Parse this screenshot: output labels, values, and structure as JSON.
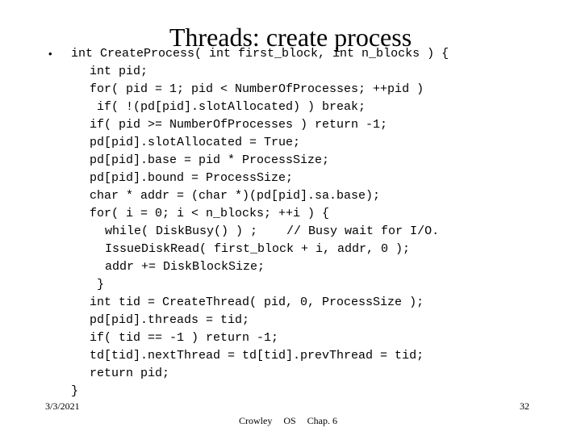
{
  "slide": {
    "title": "Threads: create process",
    "bullet_glyph": "•",
    "background_color": "#ffffff",
    "text_color": "#000000"
  },
  "code": {
    "lines": [
      {
        "indent": 0,
        "bulleted": true,
        "text": "int CreateProcess( int first_block, int n_blocks ) {"
      },
      {
        "indent": 1,
        "bulleted": false,
        "text": "int pid;"
      },
      {
        "indent": 1,
        "bulleted": false,
        "text": "for( pid = 1; pid < NumberOfProcesses; ++pid )"
      },
      {
        "indent": 2,
        "bulleted": false,
        "text": "if( !(pd[pid].slotAllocated) ) break;"
      },
      {
        "indent": 1,
        "bulleted": false,
        "text": "if( pid >= NumberOfProcesses ) return -1;"
      },
      {
        "indent": 1,
        "bulleted": false,
        "text": "pd[pid].slotAllocated = True;"
      },
      {
        "indent": 1,
        "bulleted": false,
        "text": "pd[pid].base = pid * ProcessSize;"
      },
      {
        "indent": 1,
        "bulleted": false,
        "text": "pd[pid].bound = ProcessSize;"
      },
      {
        "indent": 1,
        "bulleted": false,
        "text": "char * addr = (char *)(pd[pid].sa.base);"
      },
      {
        "indent": 1,
        "bulleted": false,
        "text": "for( i = 0; i < n_blocks; ++i ) {"
      },
      {
        "indent": 3,
        "bulleted": false,
        "text": "while( DiskBusy() ) ;    // Busy wait for I/O."
      },
      {
        "indent": 3,
        "bulleted": false,
        "text": "IssueDiskRead( first_block + i, addr, 0 );"
      },
      {
        "indent": 3,
        "bulleted": false,
        "text": "addr += DiskBlockSize;"
      },
      {
        "indent": 2,
        "bulleted": false,
        "text": "}"
      },
      {
        "indent": 1,
        "bulleted": false,
        "text": "int tid = CreateThread( pid, 0, ProcessSize );"
      },
      {
        "indent": 1,
        "bulleted": false,
        "text": "pd[pid].threads = tid;"
      },
      {
        "indent": 1,
        "bulleted": false,
        "text": "if( tid == -1 ) return -1;"
      },
      {
        "indent": 1,
        "bulleted": false,
        "text": "td[tid].nextThread = td[tid].prevThread = tid;"
      },
      {
        "indent": 1,
        "bulleted": false,
        "text": "return pid;"
      },
      {
        "indent": 0,
        "bulleted": false,
        "text": "}"
      }
    ]
  },
  "footer": {
    "date": "3/3/2021",
    "author": "Crowley",
    "course": "OS",
    "chapter": "Chap. 6",
    "page_number": "32"
  }
}
